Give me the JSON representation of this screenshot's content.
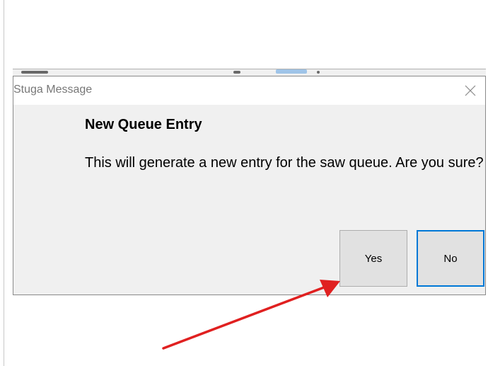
{
  "dialog": {
    "title": "Stuga Message",
    "heading": "New Queue Entry",
    "message": "This will generate a new entry for the saw queue. Are you sure?",
    "buttons": {
      "yes_label": "Yes",
      "no_label": "No",
      "default": "No"
    },
    "close_icon": "close-icon"
  },
  "annotation": {
    "arrow_color": "#e02020",
    "points_to": "Yes"
  },
  "colors": {
    "dialog_background": "#f0f0f0",
    "title_bar_background": "#ffffff",
    "focus_border": "#0078d7"
  }
}
